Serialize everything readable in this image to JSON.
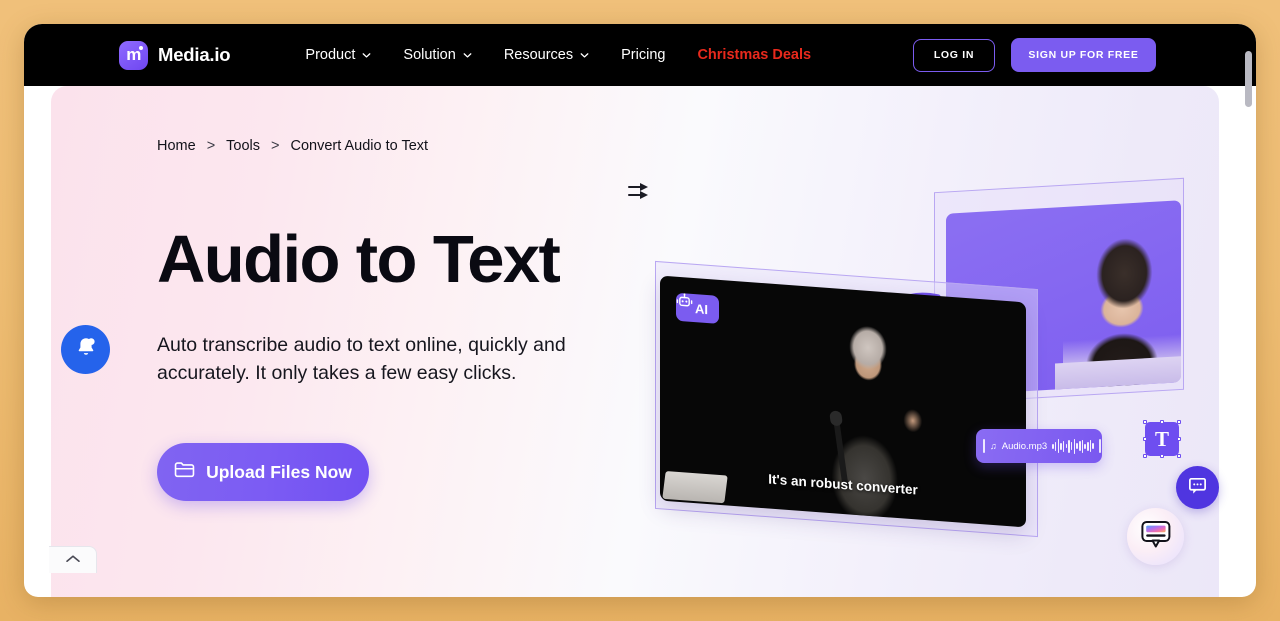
{
  "window": {
    "background_color": "#eebd73",
    "scrollbar": {
      "name": "vertical-scrollbar"
    }
  },
  "navbar": {
    "background_color": "#000000",
    "brand": {
      "mark_letter": "m",
      "name": "Media.io"
    },
    "links": [
      {
        "label": "Product",
        "has_dropdown": true
      },
      {
        "label": "Solution",
        "has_dropdown": true
      },
      {
        "label": "Resources",
        "has_dropdown": true
      },
      {
        "label": "Pricing",
        "has_dropdown": false
      },
      {
        "label": "Christmas Deals",
        "has_dropdown": false,
        "color": "#e8291c"
      }
    ],
    "login_label": "LOG IN",
    "signup_label": "SIGN UP FOR FREE",
    "accent_color": "#7b5cf0"
  },
  "hero": {
    "breadcrumb": {
      "items": [
        "Home",
        "Tools",
        "Convert Audio to Text"
      ],
      "separator": ">"
    },
    "title": "Audio to Text",
    "subtitle": "Auto transcribe audio to text online, quickly and accurately. It only takes a few easy clicks.",
    "cta_label": "Upload Files Now",
    "cta_icon": "folder-icon"
  },
  "illustration": {
    "ai_badge_label": "AI",
    "ai_badge_icon": "robot-icon",
    "video_caption": "It's an robust converter",
    "audio_chip": {
      "filename": "Audio.mp3",
      "icon": "music-note-icon"
    },
    "convert_arrow_icon": "swap-arrow-icon",
    "output_label": "T"
  },
  "widgets": {
    "notification": {
      "icon": "bell-icon",
      "color": "#2563eb"
    },
    "chat_primary": {
      "icon": "chat-bubble-icon",
      "color": "#4f35e0"
    },
    "chat_secondary": {
      "icon": "chat-bubble-gradient-icon"
    },
    "collapse": {
      "icon": "chevron-up-icon"
    }
  }
}
